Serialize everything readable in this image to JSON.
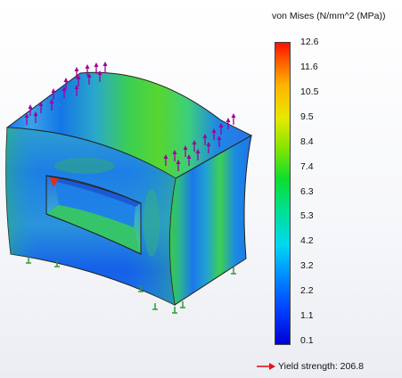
{
  "legend": {
    "title": "von Mises (N/mm^2 (MPa))",
    "ticks": [
      "12.6",
      "11.6",
      "10.5",
      "9.5",
      "8.4",
      "7.4",
      "6.3",
      "5.3",
      "4.2",
      "3.2",
      "2.2",
      "1.1",
      "0.1"
    ],
    "min": 0.1,
    "max": 12.6,
    "yield_label": "Yield strength: 206.8",
    "yield_value": 206.8
  },
  "colors": {
    "min": "#0000d8",
    "max": "#ff1000",
    "load_arrow": "#a0009a",
    "fixture": "#2e9c2e",
    "yield_arrow": "#e0141c"
  },
  "icons": {
    "load_arrows": "force-arrow-icon",
    "fixtures": "fixture-icon",
    "yield_arrow": "arrow-right-icon"
  }
}
